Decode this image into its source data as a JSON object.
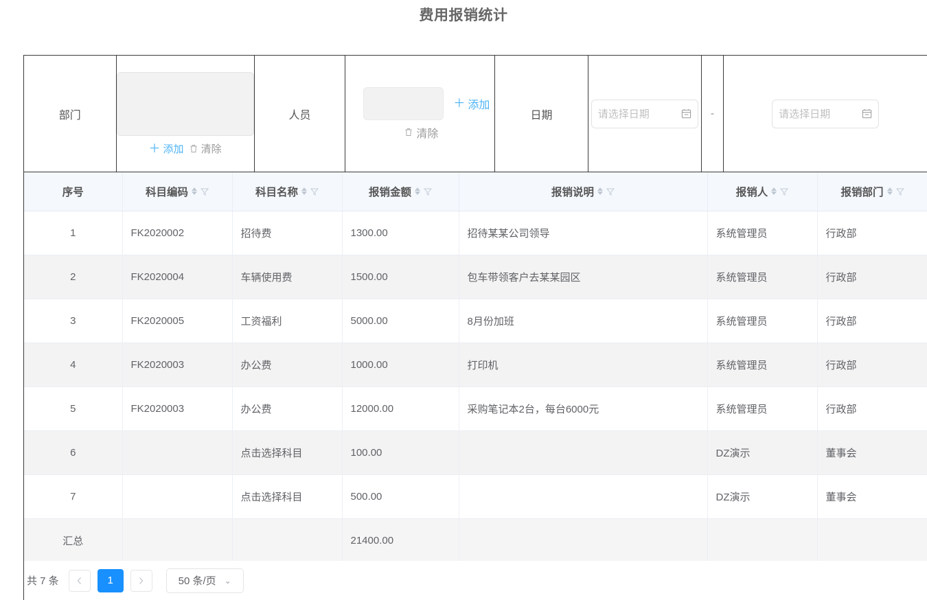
{
  "page": {
    "title": "费用报销统计"
  },
  "filters": {
    "department": {
      "label": "部门",
      "add_label": "添加",
      "clear_label": "清除"
    },
    "person": {
      "label": "人员",
      "add_label": "添加",
      "clear_label": "清除"
    },
    "date": {
      "label": "日期",
      "start_placeholder": "请选择日期",
      "end_placeholder": "请选择日期",
      "separator": "-"
    }
  },
  "table": {
    "columns": [
      {
        "key": "idx",
        "label": "序号",
        "sortable": false,
        "filterable": false
      },
      {
        "key": "code",
        "label": "科目编码",
        "sortable": true,
        "filterable": true
      },
      {
        "key": "name",
        "label": "科目名称",
        "sortable": true,
        "filterable": true
      },
      {
        "key": "amt",
        "label": "报销金额",
        "sortable": true,
        "filterable": true
      },
      {
        "key": "desc",
        "label": "报销说明",
        "sortable": true,
        "filterable": true
      },
      {
        "key": "per",
        "label": "报销人",
        "sortable": true,
        "filterable": true
      },
      {
        "key": "dept",
        "label": "报销部门",
        "sortable": true,
        "filterable": true
      }
    ],
    "rows": [
      {
        "idx": "1",
        "code": "FK2020002",
        "name": "招待费",
        "amt": "1300.00",
        "desc": "招待某某公司领导",
        "per": "系统管理员",
        "dept": "行政部"
      },
      {
        "idx": "2",
        "code": "FK2020004",
        "name": "车辆使用费",
        "amt": "1500.00",
        "desc": "包车带领客户去某某园区",
        "per": "系统管理员",
        "dept": "行政部"
      },
      {
        "idx": "3",
        "code": "FK2020005",
        "name": "工资福利",
        "amt": "5000.00",
        "desc": "8月份加班",
        "per": "系统管理员",
        "dept": "行政部"
      },
      {
        "idx": "4",
        "code": "FK2020003",
        "name": "办公费",
        "amt": "1000.00",
        "desc": "打印机",
        "per": "系统管理员",
        "dept": "行政部"
      },
      {
        "idx": "5",
        "code": "FK2020003",
        "name": "办公费",
        "amt": "12000.00",
        "desc": "采购笔记本2台，每台6000元",
        "per": "系统管理员",
        "dept": "行政部"
      },
      {
        "idx": "6",
        "code": "",
        "name": "点击选择科目",
        "amt": "100.00",
        "desc": "",
        "per": "DZ演示",
        "dept": "董事会"
      },
      {
        "idx": "7",
        "code": "",
        "name": "点击选择科目",
        "amt": "500.00",
        "desc": "",
        "per": "DZ演示",
        "dept": "董事会"
      }
    ],
    "summary": {
      "idx": "汇总",
      "code": "",
      "name": "",
      "amt": "21400.00",
      "desc": "",
      "per": "",
      "dept": ""
    }
  },
  "pagination": {
    "total_text": "共 7 条",
    "prev_icon": "chevron-left-icon",
    "next_icon": "chevron-right-icon",
    "current_page": "1",
    "page_size_label": "50 条/页"
  },
  "colors": {
    "accent": "#1890ff",
    "link": "#4cb3f5",
    "header_bg": "#f5f8fd",
    "row_alt_bg": "#f3f3f3",
    "title": "#666666"
  }
}
